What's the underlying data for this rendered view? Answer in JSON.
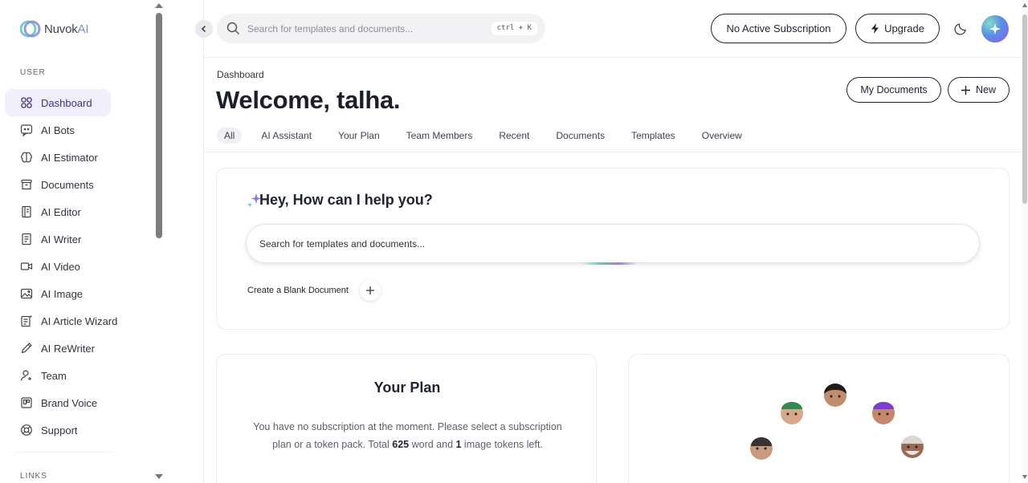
{
  "brand": {
    "name_prefix": "Nuvok",
    "name_suffix": "AI"
  },
  "sidebar": {
    "section_user": "USER",
    "section_links": "LINKS",
    "items": [
      {
        "label": "Dashboard",
        "icon": "grid-icon"
      },
      {
        "label": "AI Bots",
        "icon": "chat-bot-icon"
      },
      {
        "label": "AI Estimator",
        "icon": "brain-icon"
      },
      {
        "label": "Documents",
        "icon": "archive-icon"
      },
      {
        "label": "AI Editor",
        "icon": "notebook-icon"
      },
      {
        "label": "AI Writer",
        "icon": "document-icon"
      },
      {
        "label": "AI Video",
        "icon": "video-icon"
      },
      {
        "label": "AI Image",
        "icon": "image-icon"
      },
      {
        "label": "AI Article Wizard",
        "icon": "article-icon"
      },
      {
        "label": "AI ReWriter",
        "icon": "pencil-icon"
      },
      {
        "label": "Team",
        "icon": "user-plus-icon"
      },
      {
        "label": "Brand Voice",
        "icon": "brand-icon"
      },
      {
        "label": "Support",
        "icon": "lifebuoy-icon"
      }
    ]
  },
  "topbar": {
    "search_placeholder": "Search for templates and documents...",
    "shortcut": "ctrl + K",
    "subscription_label": "No Active Subscription",
    "upgrade_label": "Upgrade"
  },
  "main": {
    "breadcrumb": "Dashboard",
    "welcome": "Welcome, talha.",
    "my_documents_label": "My Documents",
    "new_label": "New",
    "tabs": [
      "All",
      "AI Assistant",
      "Your Plan",
      "Team Members",
      "Recent",
      "Documents",
      "Templates",
      "Overview"
    ],
    "help": {
      "title": "Hey, How can I help you?",
      "search_placeholder": "Search for templates and documents...",
      "blank_doc_label": "Create a Blank Document"
    },
    "plan": {
      "title": "Your Plan",
      "text_before": "You have no subscription at the moment. Please select a subscription plan or a token pack. Total ",
      "words": "625",
      "text_middle": " word and ",
      "images": "1",
      "text_after": " image tokens left."
    }
  },
  "colors": {
    "accent": "#3c2f8f",
    "active_bg": "#f1effb",
    "logo_accent": "#7f8ad8"
  }
}
